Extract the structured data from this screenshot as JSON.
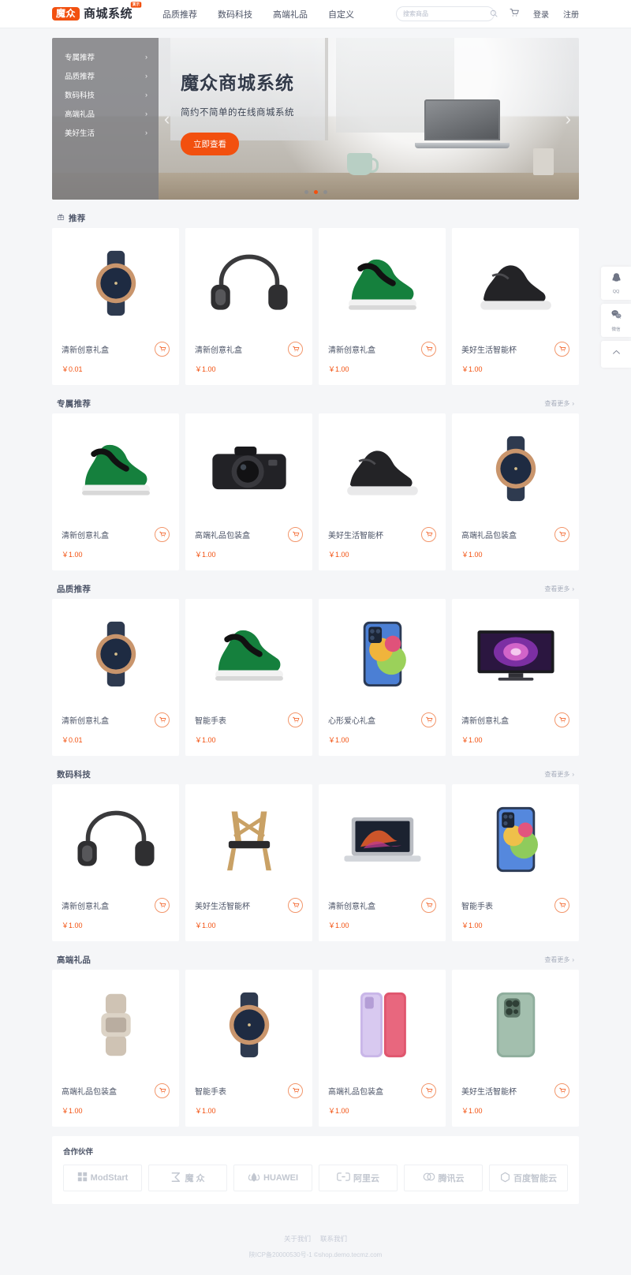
{
  "header": {
    "logo_badge": "魔众",
    "logo_text": "商城系统",
    "logo_sup": "演示",
    "nav": [
      {
        "label": "品质推荐"
      },
      {
        "label": "数码科技"
      },
      {
        "label": "高端礼品"
      },
      {
        "label": "自定义"
      }
    ],
    "search_placeholder": "搜索商品",
    "search_value": "",
    "search_icon": "search-icon",
    "cart_icon": "cart-icon",
    "login": "登录",
    "register": "注册"
  },
  "hero": {
    "categories": [
      {
        "label": "专属推荐"
      },
      {
        "label": "品质推荐"
      },
      {
        "label": "数码科技"
      },
      {
        "label": "高端礼品"
      },
      {
        "label": "美好生活"
      }
    ],
    "chevron": "›",
    "title": "魔众商城系统",
    "subtitle": "简约不简单的在线商城系统",
    "button": "立即查看",
    "arrow_left": "‹",
    "arrow_right": "›",
    "dots": [
      false,
      true,
      false
    ],
    "accent_color": "#f2500f"
  },
  "sections": [
    {
      "title": "推荐",
      "icon": "gift-icon",
      "more": "",
      "products": [
        {
          "name": "清新创意礼盒",
          "price": "￥0.01",
          "image": "watch"
        },
        {
          "name": "清新创意礼盒",
          "price": "￥1.00",
          "image": "headphone"
        },
        {
          "name": "清新创意礼盒",
          "price": "￥1.00",
          "image": "sneaker-green"
        },
        {
          "name": "美好生活智能杯",
          "price": "￥1.00",
          "image": "boot"
        }
      ]
    },
    {
      "title": "专属推荐",
      "icon": "",
      "more": "查看更多",
      "products": [
        {
          "name": "清新创意礼盒",
          "price": "￥1.00",
          "image": "sneaker-green"
        },
        {
          "name": "高端礼品包装盒",
          "price": "￥1.00",
          "image": "camera"
        },
        {
          "name": "美好生活智能杯",
          "price": "￥1.00",
          "image": "boot"
        },
        {
          "name": "高端礼品包装盒",
          "price": "￥1.00",
          "image": "watch"
        }
      ]
    },
    {
      "title": "品质推荐",
      "icon": "",
      "more": "查看更多",
      "products": [
        {
          "name": "清新创意礼盒",
          "price": "￥0.01",
          "image": "watch"
        },
        {
          "name": "智能手表",
          "price": "￥1.00",
          "image": "sneaker-green"
        },
        {
          "name": "心形爱心礼盒",
          "price": "￥1.00",
          "image": "phone-colorful"
        },
        {
          "name": "清新创意礼盒",
          "price": "￥1.00",
          "image": "tv"
        }
      ]
    },
    {
      "title": "数码科技",
      "icon": "",
      "more": "查看更多",
      "products": [
        {
          "name": "清新创意礼盒",
          "price": "￥1.00",
          "image": "headphone"
        },
        {
          "name": "美好生活智能杯",
          "price": "￥1.00",
          "image": "chair"
        },
        {
          "name": "清新创意礼盒",
          "price": "￥1.00",
          "image": "laptop"
        },
        {
          "name": "智能手表",
          "price": "￥1.00",
          "image": "phone-blue"
        }
      ]
    },
    {
      "title": "高端礼品",
      "icon": "",
      "more": "查看更多",
      "products": [
        {
          "name": "高端礼品包装盒",
          "price": "￥1.00",
          "image": "watch-silver"
        },
        {
          "name": "智能手表",
          "price": "￥1.00",
          "image": "watch"
        },
        {
          "name": "高端礼品包装盒",
          "price": "￥1.00",
          "image": "phone-pink"
        },
        {
          "name": "美好生活智能杯",
          "price": "￥1.00",
          "image": "phone-green"
        }
      ]
    }
  ],
  "partners": {
    "title": "合作伙伴",
    "items": [
      {
        "label": "ModStart",
        "icon": "grid-icon"
      },
      {
        "label": "魔 众",
        "icon": "mz-icon"
      },
      {
        "label": "HUAWEI",
        "icon": "huawei-icon"
      },
      {
        "label": "阿里云",
        "icon": "aliyun-icon"
      },
      {
        "label": "腾讯云",
        "icon": "tencent-icon"
      },
      {
        "label": "百度智能云",
        "icon": "baidu-icon"
      }
    ]
  },
  "footer": {
    "links": [
      {
        "label": "关于我们"
      },
      {
        "label": "联系我们"
      }
    ],
    "copyright": "陕ICP备20000530号-1 ©shop.demo.tecmz.com"
  },
  "float_bar": {
    "items": [
      {
        "label": "QQ",
        "icon": "qq-icon"
      },
      {
        "label": "微信",
        "icon": "wechat-icon"
      }
    ],
    "top_icon": "chevron-up-icon"
  }
}
